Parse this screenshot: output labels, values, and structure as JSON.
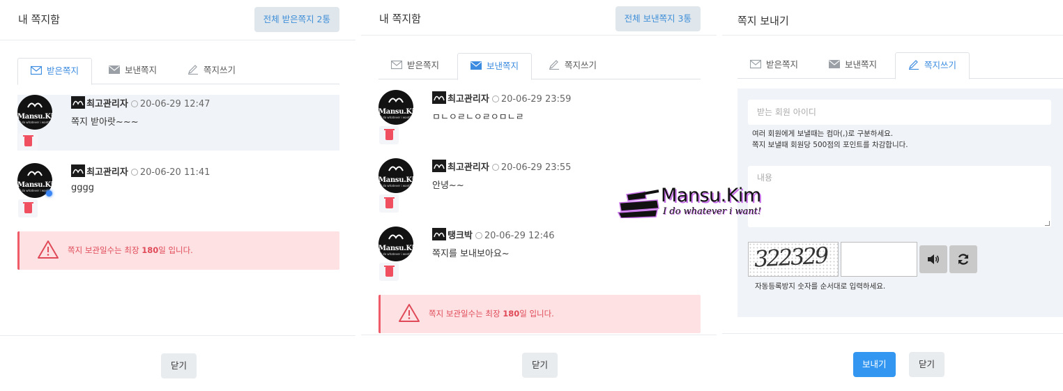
{
  "inbox_panel": {
    "title": "내 쪽지함",
    "count_button": "전체 받은쪽지 2통",
    "tabs": [
      {
        "label": "받은쪽지"
      },
      {
        "label": "보낸쪽지"
      },
      {
        "label": "쪽지쓰기"
      }
    ],
    "active_tab": "받은쪽지",
    "messages": [
      {
        "name": "최고관리자",
        "date": "20-06-29 12:47",
        "body": "쪽지 받아랏~~~",
        "highlighted": true
      },
      {
        "name": "최고관리자",
        "date": "20-06-20 11:41",
        "body": "gggg",
        "highlighted": false
      }
    ],
    "notice": {
      "before": "쪽지 보관일수는 최장 ",
      "days": "180",
      "after": "일 입니다."
    },
    "close_label": "닫기"
  },
  "sent_panel": {
    "title": "내 쪽지함",
    "count_button": "전체 보낸쪽지 3통",
    "tabs": [
      {
        "label": "받은쪽지"
      },
      {
        "label": "보낸쪽지"
      },
      {
        "label": "쪽지쓰기"
      }
    ],
    "active_tab": "보낸쪽지",
    "messages": [
      {
        "name": "최고관리자",
        "date": "20-06-29 23:59",
        "body": "ㅁㄴㅇㄹㄴㅇㄹㅇㅁㄴㄹ"
      },
      {
        "name": "최고관리자",
        "date": "20-06-29 23:55",
        "body": "안녕~~"
      },
      {
        "name": "탱크박",
        "date": "20-06-29 12:46",
        "body": "쪽지를 보내보아요~"
      }
    ],
    "notice": {
      "before": "쪽지 보관일수는 최장 ",
      "days": "180",
      "after": "일 입니다."
    },
    "close_label": "닫기"
  },
  "write_panel": {
    "title": "쪽지 보내기",
    "tabs": [
      {
        "label": "받은쪽지"
      },
      {
        "label": "보낸쪽지"
      },
      {
        "label": "쪽지쓰기"
      }
    ],
    "active_tab": "쪽지쓰기",
    "recipient_placeholder": "받는 회원 아이디",
    "help_line1": "여러 회원에게 보낼때는 컴마(,)로 구분하세요.",
    "help_line2": "쪽지 보낼때 회원당 500점의 포인트를 차감합니다.",
    "content_placeholder": "내용",
    "captcha_text": "322329",
    "captcha_help": "자동등록방지 숫자를 순서대로 입력하세요.",
    "send_label": "보내기",
    "close_label": "닫기"
  },
  "avatar": {
    "text": "Mansu.Kim",
    "sub": "I do whatever i want!"
  },
  "watermark": {
    "title": "Mansu.Kim",
    "subtitle": "I do whatever i want!"
  },
  "colors": {
    "accent": "#3b8be0",
    "send": "#3397f1",
    "notice_bg": "#fde1e3",
    "notice_text": "#e04a58",
    "trash": "#ef4f5f"
  }
}
